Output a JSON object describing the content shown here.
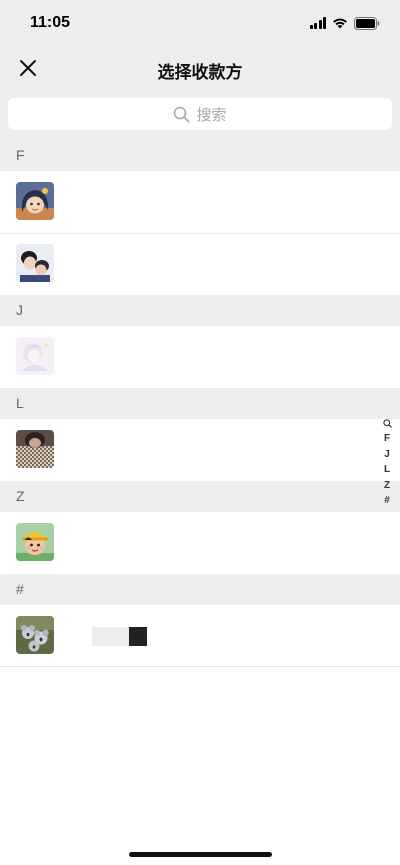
{
  "status_bar": {
    "time": "11:05",
    "icons": [
      "cellular-signal-icon",
      "wifi-icon",
      "battery-icon"
    ]
  },
  "nav": {
    "close_icon": "close-icon",
    "title": "选择收款方"
  },
  "search": {
    "icon": "search-icon",
    "placeholder": "搜索"
  },
  "sections": [
    {
      "letter": "F",
      "contacts": [
        {
          "avatar": "avatar-cartoon-girl"
        },
        {
          "avatar": "avatar-couple-photo"
        }
      ]
    },
    {
      "letter": "J",
      "contacts": [
        {
          "avatar": "avatar-faded-illustration"
        }
      ]
    },
    {
      "letter": "L",
      "contacts": [
        {
          "avatar": "avatar-photo-checkered"
        }
      ]
    },
    {
      "letter": "Z",
      "contacts": [
        {
          "avatar": "avatar-cartoon-boy-hat"
        }
      ]
    },
    {
      "letter": "#",
      "contacts": [
        {
          "avatar": "avatar-koalas"
        }
      ]
    }
  ],
  "index_bar": [
    "Q",
    "F",
    "J",
    "L",
    "Z",
    "#"
  ],
  "colors": {
    "background": "#ededed",
    "surface": "#ffffff",
    "text_primary": "#111111",
    "text_secondary": "#666666",
    "placeholder": "#a8a8a8"
  }
}
